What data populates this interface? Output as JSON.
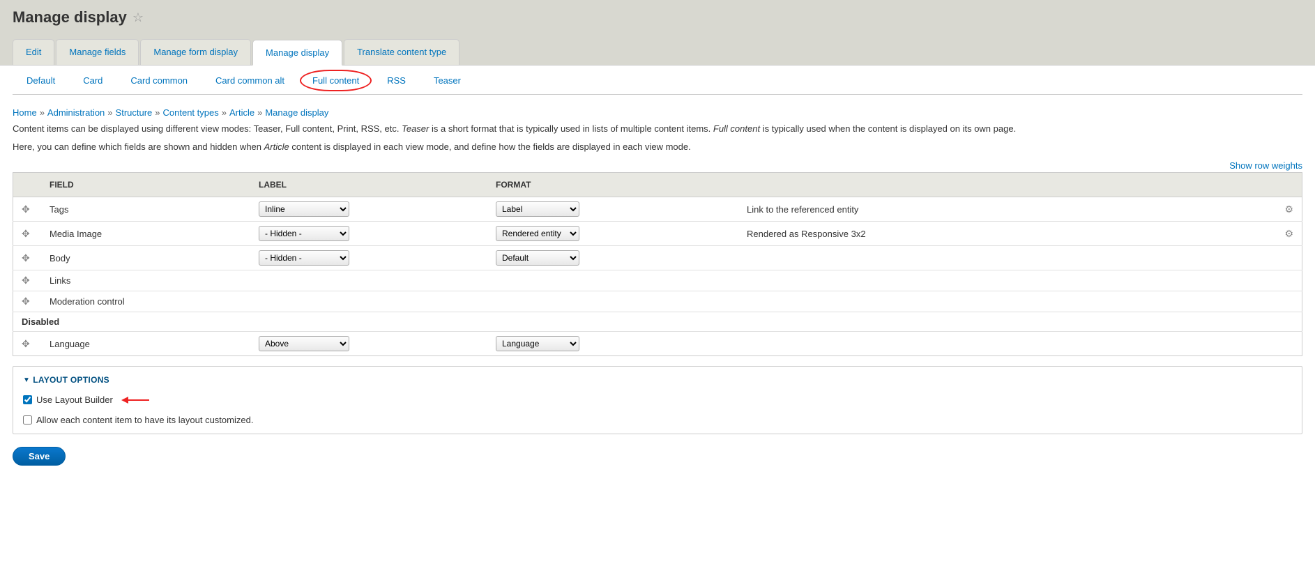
{
  "page": {
    "title": "Manage display"
  },
  "primary_tabs": [
    {
      "label": "Edit",
      "active": false
    },
    {
      "label": "Manage fields",
      "active": false
    },
    {
      "label": "Manage form display",
      "active": false
    },
    {
      "label": "Manage display",
      "active": true
    },
    {
      "label": "Translate content type",
      "active": false
    }
  ],
  "secondary_tabs": [
    {
      "label": "Default",
      "circled": false
    },
    {
      "label": "Card",
      "circled": false
    },
    {
      "label": "Card common",
      "circled": false
    },
    {
      "label": "Card common alt",
      "circled": false
    },
    {
      "label": "Full content",
      "circled": true
    },
    {
      "label": "RSS",
      "circled": false
    },
    {
      "label": "Teaser",
      "circled": false
    }
  ],
  "breadcrumb": [
    "Home",
    "Administration",
    "Structure",
    "Content types",
    "Article",
    "Manage display"
  ],
  "help": {
    "line1_pre": "Content items can be displayed using different view modes: Teaser, Full content, Print, RSS, etc. ",
    "line1_em1": "Teaser",
    "line1_mid": " is a short format that is typically used in lists of multiple content items. ",
    "line1_em2": "Full content",
    "line1_post": " is typically used when the content is displayed on its own page.",
    "line2_pre": "Here, you can define which fields are shown and hidden when ",
    "line2_em": "Article",
    "line2_post": " content is displayed in each view mode, and define how the fields are displayed in each view mode."
  },
  "row_weights_label": "Show row weights",
  "table": {
    "headers": {
      "field": "Field",
      "label": "Label",
      "format": "Format"
    },
    "rows": [
      {
        "drag": true,
        "field": "Tags",
        "label_select": "Inline",
        "format_select": "Label",
        "extra": "Link to the referenced entity",
        "gear": true
      },
      {
        "drag": true,
        "field": "Media Image",
        "label_select": "- Hidden -",
        "format_select": "Rendered entity",
        "extra": "Rendered as Responsive 3x2",
        "gear": true
      },
      {
        "drag": true,
        "field": "Body",
        "label_select": "- Hidden -",
        "format_select": "Default",
        "extra": "",
        "gear": false
      },
      {
        "drag": true,
        "field": "Links",
        "label_select": "",
        "format_select": "",
        "extra": "",
        "gear": false
      },
      {
        "drag": true,
        "field": "Moderation control",
        "label_select": "",
        "format_select": "",
        "extra": "",
        "gear": false
      }
    ],
    "disabled_label": "Disabled",
    "disabled_rows": [
      {
        "drag": true,
        "field": "Language",
        "label_select": "Above",
        "format_select": "Language",
        "extra": "",
        "gear": false
      }
    ]
  },
  "layout": {
    "summary": "Layout options",
    "cb1_label": "Use Layout Builder",
    "cb1_checked": true,
    "cb2_label": "Allow each content item to have its layout customized.",
    "cb2_checked": false
  },
  "save_label": "Save"
}
